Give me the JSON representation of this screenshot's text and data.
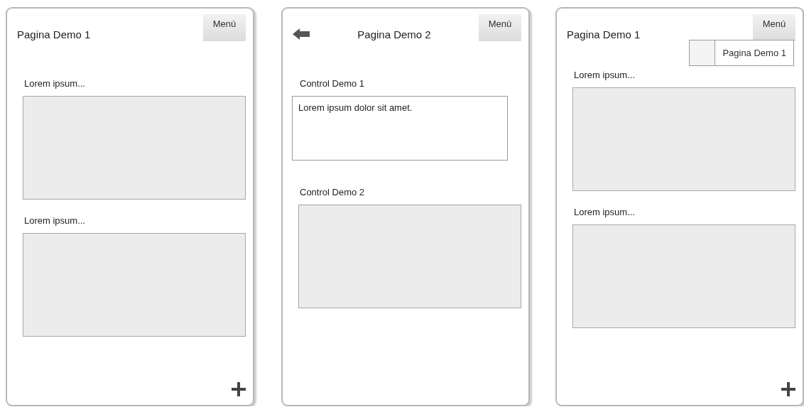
{
  "phones": [
    {
      "title": "Pagina Demo 1",
      "back": false,
      "menu": {
        "label": "Menú"
      },
      "add_button": true,
      "blocks": [
        {
          "kind": "label",
          "text": "Lorem ipsum..."
        },
        {
          "kind": "panel"
        },
        {
          "kind": "label",
          "text": "Lorem ipsum..."
        },
        {
          "kind": "panel"
        }
      ]
    },
    {
      "title": "Pagina Demo 2",
      "back": true,
      "menu": {
        "label": "Menú"
      },
      "add_button": false,
      "blocks": [
        {
          "kind": "label",
          "text": "Control Demo 1"
        },
        {
          "kind": "textarea",
          "value": "Lorem ipsum dolor sit amet."
        },
        {
          "kind": "label",
          "text": "Control Demo 2"
        },
        {
          "kind": "panel"
        }
      ]
    },
    {
      "title": "Pagina Demo 1",
      "back": false,
      "menu": {
        "label": "Menú",
        "items": [
          {
            "label": "Pagina Demo 1"
          }
        ]
      },
      "add_button": true,
      "blocks": [
        {
          "kind": "label",
          "text": "Lorem ipsum..."
        },
        {
          "kind": "panel"
        },
        {
          "kind": "label",
          "text": "Lorem ipsum..."
        },
        {
          "kind": "panel"
        }
      ]
    }
  ]
}
